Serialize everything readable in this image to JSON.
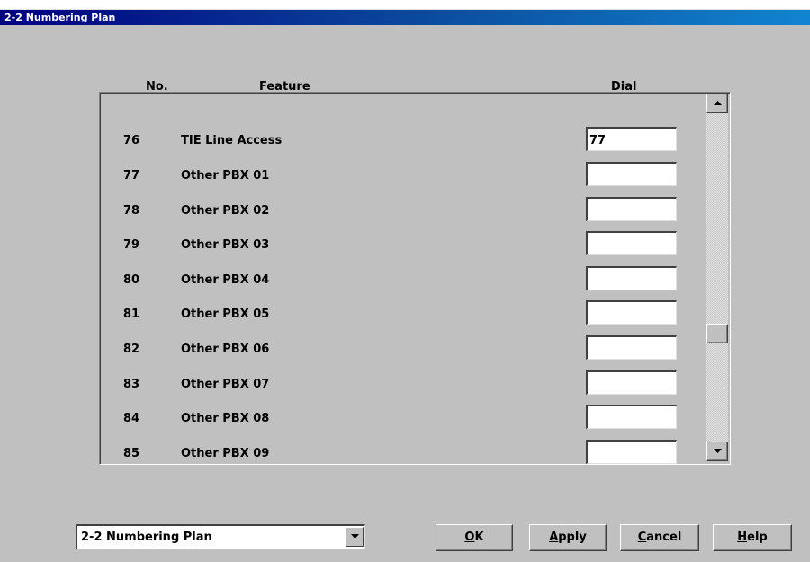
{
  "window": {
    "title": "2-2 Numbering Plan"
  },
  "columns": {
    "no": "No.",
    "feature": "Feature",
    "dial": "Dial"
  },
  "rows": [
    {
      "no": "76",
      "feature": "TIE Line Access",
      "dial": "77"
    },
    {
      "no": "77",
      "feature": "Other PBX 01",
      "dial": ""
    },
    {
      "no": "78",
      "feature": "Other PBX 02",
      "dial": ""
    },
    {
      "no": "79",
      "feature": "Other PBX 03",
      "dial": ""
    },
    {
      "no": "80",
      "feature": "Other PBX 04",
      "dial": ""
    },
    {
      "no": "81",
      "feature": "Other PBX 05",
      "dial": ""
    },
    {
      "no": "82",
      "feature": "Other PBX 06",
      "dial": ""
    },
    {
      "no": "83",
      "feature": "Other PBX 07",
      "dial": ""
    },
    {
      "no": "84",
      "feature": "Other PBX 08",
      "dial": ""
    },
    {
      "no": "85",
      "feature": "Other PBX 09",
      "dial": ""
    }
  ],
  "footer": {
    "page_select": "2-2 Numbering Plan",
    "buttons": {
      "ok": {
        "mnemonic": "O",
        "rest": "K"
      },
      "apply": {
        "mnemonic": "A",
        "rest": "pply"
      },
      "cancel": {
        "mnemonic": "C",
        "rest": "ancel"
      },
      "help": {
        "mnemonic": "H",
        "rest": "elp"
      }
    }
  },
  "icons": {
    "scroll_up": "arrow-up-icon",
    "scroll_down": "arrow-down-icon",
    "dropdown": "chevron-down-icon"
  }
}
